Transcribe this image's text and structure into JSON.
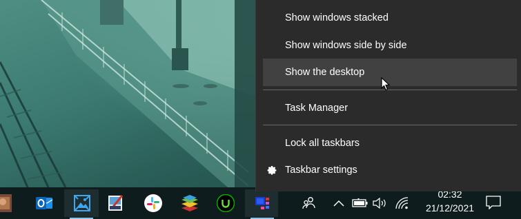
{
  "context_menu": {
    "items": [
      {
        "label": "Show windows stacked",
        "icon": ""
      },
      {
        "label": "Show windows side by side",
        "icon": ""
      },
      {
        "label": "Show the desktop",
        "icon": "",
        "state": "hovered"
      },
      {
        "label": "Task Manager",
        "icon": ""
      },
      {
        "label": "Lock all taskbars",
        "icon": ""
      },
      {
        "label": "Taskbar settings",
        "icon": "gear-icon"
      }
    ]
  },
  "taskbar": {
    "apps": [
      {
        "name": "app-icon-photo"
      },
      {
        "name": "outlook-icon"
      },
      {
        "name": "photos-icon",
        "running": true
      },
      {
        "name": "paint-icon"
      },
      {
        "name": "slack-icon"
      },
      {
        "name": "bluestacks-icon"
      },
      {
        "name": "upwork-icon"
      },
      {
        "name": "taskbar-app-icon-active",
        "running": true,
        "active": true
      }
    ],
    "tray": {
      "icons": [
        "people-icon",
        "chevron-up-icon",
        "battery-icon",
        "speaker-icon",
        "wifi-icon"
      ]
    },
    "clock": {
      "time": "02:32",
      "date": "21/12/2021"
    },
    "notification_icon": "action-center-icon"
  },
  "colors": {
    "menu_bg": "#2b2b2b",
    "menu_hover": "#414141",
    "taskbar_bg": "#0f1c1e",
    "accent_underline": "#8ec3ea"
  }
}
